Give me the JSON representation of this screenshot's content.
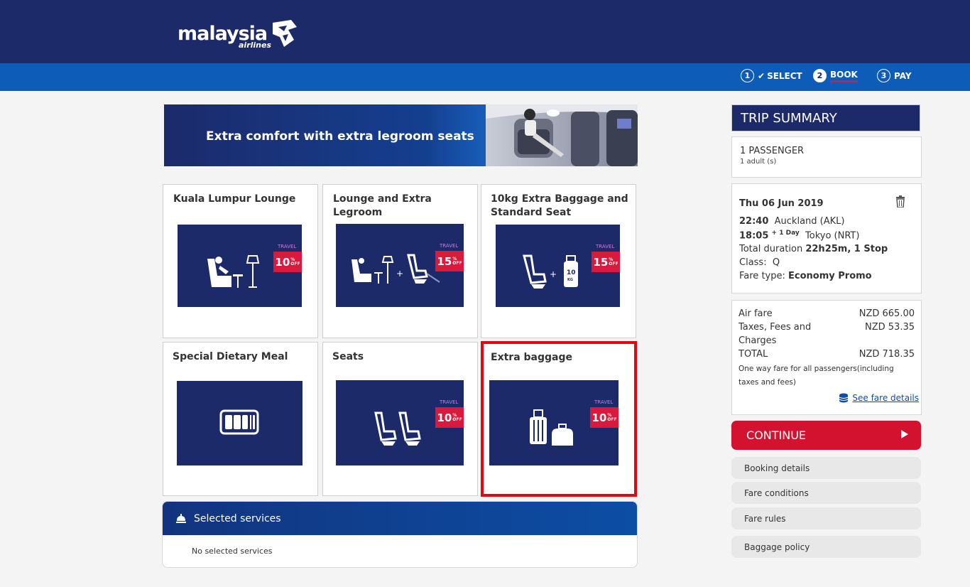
{
  "header": {
    "logo_text": "malaysia",
    "logo_sub": "airlines"
  },
  "steps": [
    {
      "num": "1",
      "label": "SELECT",
      "done": true
    },
    {
      "num": "2",
      "label": "BOOK",
      "active": true
    },
    {
      "num": "3",
      "label": "PAY"
    }
  ],
  "banner": {
    "text": "Extra comfort with extra legroom seats"
  },
  "cards": [
    {
      "title": "Kuala Lumpur Lounge",
      "discount": "10"
    },
    {
      "title": "Lounge and Extra Legroom",
      "discount": "15"
    },
    {
      "title": "10kg Extra Baggage and Standard Seat",
      "discount": "15",
      "bag_label": "10",
      "bag_unit": "KG"
    },
    {
      "title": "Special Dietary Meal"
    },
    {
      "title": "Seats",
      "discount": "10"
    },
    {
      "title": "Extra baggage",
      "discount": "10",
      "selected": true
    }
  ],
  "badge": {
    "pct": "%",
    "off": "OFF"
  },
  "selected_services": {
    "title": "Selected services",
    "empty_text": "No selected services"
  },
  "trip_summary": {
    "title": "TRIP SUMMARY",
    "passengers": "1 PASSENGER",
    "adults": "1 adult (s)",
    "date": "Thu 06 Jun 2019",
    "dep_time": "22:40",
    "dep_place": "Auckland (AKL)",
    "arr_time": "18:05",
    "arr_plus": "+ 1 Day",
    "arr_place": "Tokyo (NRT)",
    "duration_label": "Total  duration",
    "duration_value": "22h25m, 1 Stop",
    "class_label": "Class:",
    "class_value": "Q",
    "fare_type_label": "Fare type:",
    "fare_type_value": "Economy Promo",
    "air_fare_label": "Air fare",
    "air_fare_value": "NZD 665.00",
    "taxes_label1": "Taxes, Fees and",
    "taxes_label2": "Charges",
    "taxes_value": "NZD 53.35",
    "total_label": "TOTAL",
    "total_value": "NZD 718.35",
    "note": "One way fare for all passengers(including taxes and fees)",
    "fare_details_link": "See fare details",
    "continue_label": "CONTINUE",
    "links": [
      "Booking details",
      "Fare conditions",
      "Fare rules",
      "Baggage policy"
    ]
  },
  "colors": {
    "navy": "#1c2a6a",
    "blue": "#0d5cb8",
    "red": "#d3122f",
    "select_red": "#e30613"
  }
}
